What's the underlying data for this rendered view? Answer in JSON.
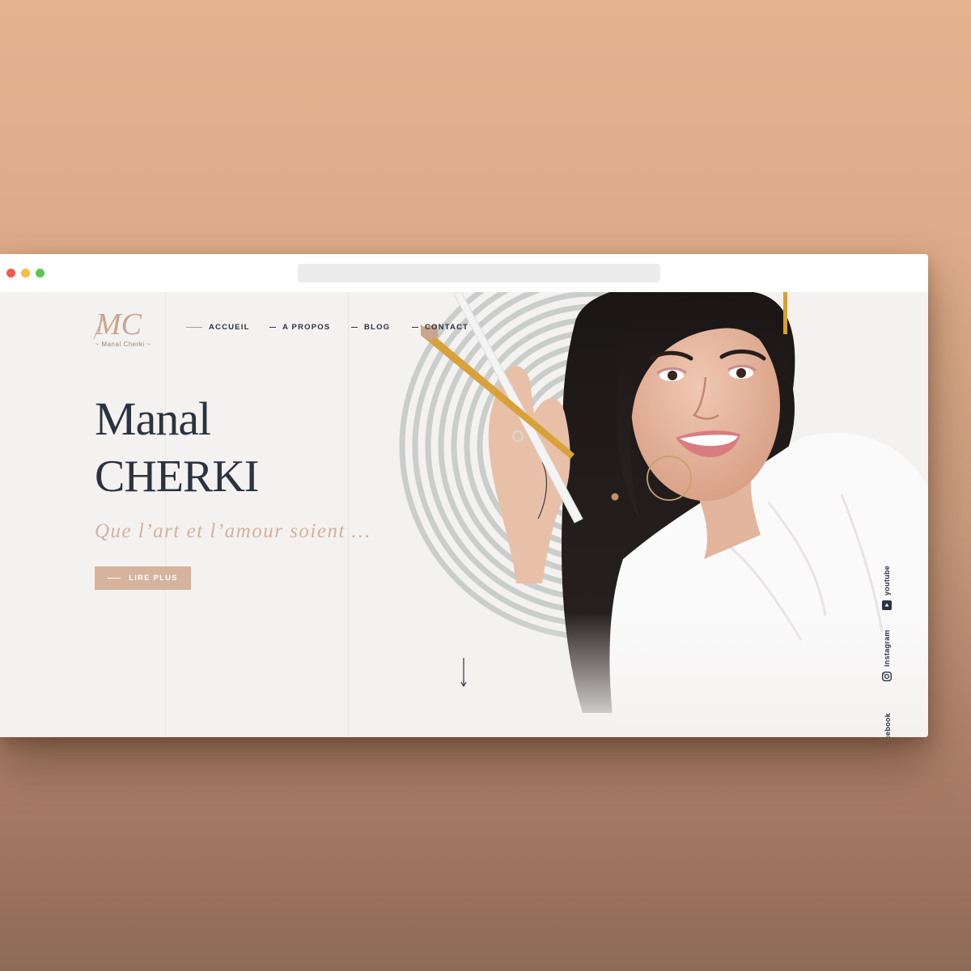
{
  "browser": {
    "window_controls": [
      "close",
      "minimize",
      "maximize"
    ],
    "url": ""
  },
  "logo": {
    "monogram": "MC",
    "name": "~ Manal Cherki ~",
    "color": "#c9a591"
  },
  "nav": {
    "items": [
      {
        "label": "ACCUEIL"
      },
      {
        "label": "A PROPOS"
      },
      {
        "label": "BLOG"
      },
      {
        "label": "CONTACT"
      }
    ]
  },
  "hero": {
    "first_name": "Manal",
    "last_name": "CHERKI",
    "tagline": "Que l’art et l’amour soient …",
    "cta_label": "LIRE PLUS",
    "scroll_icon": "arrow-down-icon"
  },
  "social": {
    "items": [
      {
        "label": "youtube",
        "icon": "youtube-icon"
      },
      {
        "label": "instagram",
        "icon": "instagram-icon"
      },
      {
        "label": "facebook",
        "icon": "facebook-icon"
      }
    ]
  },
  "colors": {
    "background": "#f4f2f0",
    "text": "#2b3340",
    "accent": "#d5b39c",
    "circles": "#c9cdcb"
  }
}
